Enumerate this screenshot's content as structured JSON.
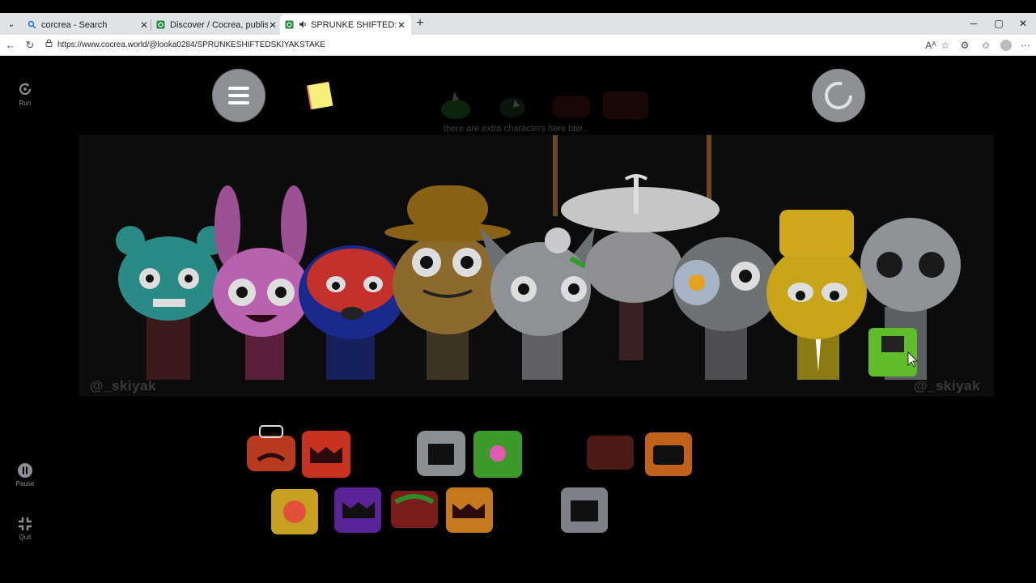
{
  "browser": {
    "tabs": [
      {
        "title": "corcrea - Search",
        "active": false,
        "icon": "search-icon"
      },
      {
        "title": "Discover / Cocrea, publish a Scratch",
        "active": false,
        "icon": "cocrea-icon"
      },
      {
        "title": "SPRUNKE SHIFTED: SKIYAKS T",
        "active": true,
        "icon": "cocrea-icon",
        "audio": true
      }
    ],
    "url": "https://www.cocrea.world/@looka0284/SPRUNKESHIFTEDSKIYAKSTAKE",
    "new_tab_label": "+",
    "window_controls": {
      "minimize": "─",
      "maximize": "▢",
      "close": "✕"
    }
  },
  "player": {
    "run_label": "Run",
    "pause_label": "Pause",
    "quit_label": "Quit"
  },
  "game": {
    "hint_text": "there are extra characters here btw...",
    "signature_left": "@_skiyak",
    "signature_right": "@_skiyak",
    "characters": [
      {
        "name": "teal-bear",
        "color": "#2a8a86"
      },
      {
        "name": "pink-bunny",
        "color": "#c46ab8"
      },
      {
        "name": "red-blue-fuzzy",
        "color": "#c4302c"
      },
      {
        "name": "brown-hat",
        "color": "#8c6a2c"
      },
      {
        "name": "gray-cat",
        "color": "#8e9296"
      },
      {
        "name": "white-saucer",
        "color": "#b7b8bb"
      },
      {
        "name": "flower-gray",
        "color": "#6f7275"
      },
      {
        "name": "yellow-suit",
        "color": "#c8a419"
      },
      {
        "name": "gray-tall",
        "color": "#8f9398"
      }
    ],
    "sound_icons": [
      {
        "name": "sound-hat",
        "color": "#b83a1f"
      },
      {
        "name": "sound-red-teeth",
        "color": "#c73320"
      },
      {
        "name": "sound-gray-mouth",
        "color": "#8a8f94"
      },
      {
        "name": "sound-green-flower",
        "color": "#3b9a2a"
      },
      {
        "name": "sound-dark-red",
        "color": "#5e1f1a"
      },
      {
        "name": "sound-orange-mouth",
        "color": "#c2621a"
      },
      {
        "name": "sound-yellow-sun",
        "color": "#c8a021"
      },
      {
        "name": "sound-purple",
        "color": "#5a2398"
      },
      {
        "name": "sound-red-green",
        "color": "#7a1d1a"
      },
      {
        "name": "sound-orange-teeth",
        "color": "#c47a1c"
      },
      {
        "name": "sound-gray-teeth",
        "color": "#7d8187"
      }
    ]
  }
}
